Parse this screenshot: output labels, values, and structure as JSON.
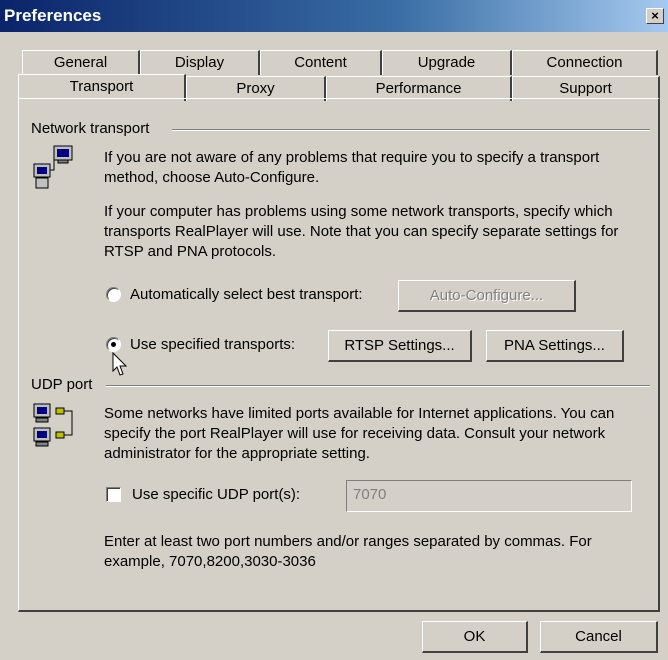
{
  "window": {
    "title": "Preferences",
    "close_glyph": "×"
  },
  "tabs_row1": [
    {
      "label": "General"
    },
    {
      "label": "Display"
    },
    {
      "label": "Content"
    },
    {
      "label": "Upgrade"
    },
    {
      "label": "Connection"
    }
  ],
  "tabs_row2": [
    {
      "label": "Transport",
      "active": true
    },
    {
      "label": "Proxy"
    },
    {
      "label": "Performance"
    },
    {
      "label": "Support"
    }
  ],
  "network": {
    "group_label": "Network transport",
    "icon": "network-computers-icon",
    "para1": "If you are not aware of any problems that require you to specify a transport method, choose Auto-Configure.",
    "para2": "If your computer has problems using some network transports, specify which transports RealPlayer will use. Note that you can specify separate settings for RTSP and PNA protocols.",
    "radio_auto_label": "Automatically select best transport:",
    "auto_configure_button": "Auto-Configure...",
    "radio_specified_label": "Use specified transports:",
    "radio_selected": "specified",
    "rtsp_button": "RTSP Settings...",
    "pna_button": "PNA Settings..."
  },
  "udp": {
    "group_label": "UDP port",
    "icon": "udp-ports-icon",
    "para1": "Some networks have limited ports available for Internet applications. You can specify the port RealPlayer will use for receiving data. Consult your network administrator for the appropriate setting.",
    "checkbox_label": "Use specific UDP port(s):",
    "checked": false,
    "port_value": "7070",
    "hint": "Enter at least two port numbers and/or ranges separated by commas. For example, 7070,8200,3030-3036"
  },
  "footer": {
    "ok_button": "OK",
    "cancel_button": "Cancel"
  },
  "colors": {
    "face": "#d4d0c8",
    "title_start": "#0a246a",
    "title_end": "#a6caf0"
  }
}
